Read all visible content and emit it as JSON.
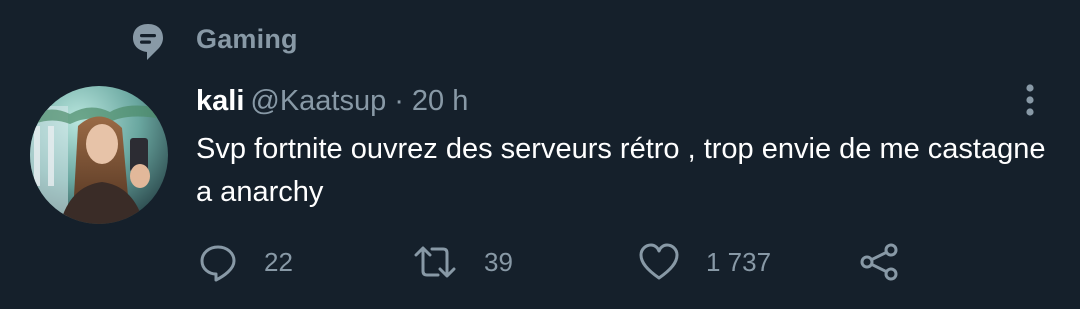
{
  "topic": {
    "label": "Gaming",
    "icon": "topic-bubble-icon"
  },
  "tweet": {
    "author_name": "kali",
    "author_handle": "@Kaatsup",
    "separator": "·",
    "timestamp": "20 h",
    "text": "Svp fortnite ouvrez des serveurs rétro , trop envie de me castagne a anarchy"
  },
  "actions": {
    "reply_count": "22",
    "retweet_count": "39",
    "like_count": "1 737"
  },
  "icons": {
    "reply": "reply-icon",
    "retweet": "retweet-icon",
    "like": "heart-icon",
    "share": "share-icon",
    "more": "more-vertical-icon"
  },
  "colors": {
    "background": "#15202b",
    "text_primary": "#ffffff",
    "text_secondary": "#8899a6"
  }
}
